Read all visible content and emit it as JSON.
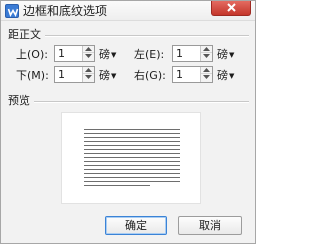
{
  "window": {
    "title": "边框和底纹选项"
  },
  "margins": {
    "section_title": "距正文",
    "top": {
      "label": "上(O):",
      "value": "1",
      "unit": "磅"
    },
    "bottom": {
      "label": "下(M):",
      "value": "1",
      "unit": "磅"
    },
    "left": {
      "label": "左(E):",
      "value": "1",
      "unit": "磅"
    },
    "right": {
      "label": "右(G):",
      "value": "1",
      "unit": "磅"
    }
  },
  "preview": {
    "section_title": "预览"
  },
  "buttons": {
    "ok": "确定",
    "cancel": "取消"
  },
  "colors": {
    "close_button": "#c4362b",
    "app_icon": "#3a7bd5",
    "dialog_bg": "#f2f2f2"
  }
}
